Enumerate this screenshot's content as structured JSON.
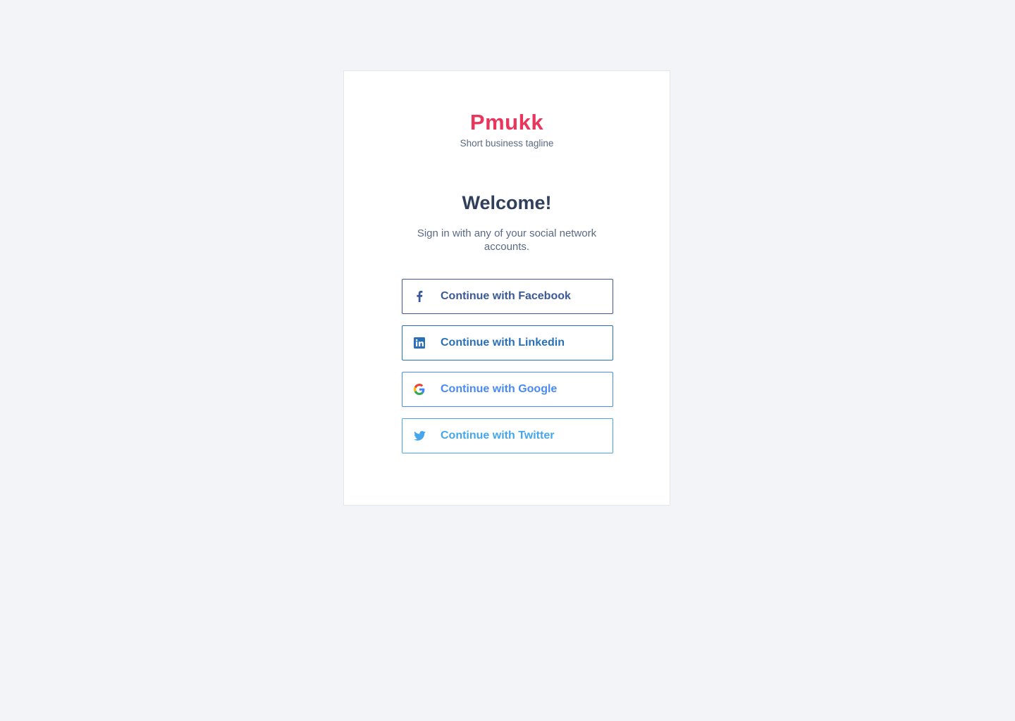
{
  "brand": {
    "name": "Pmukk",
    "tagline": "Short business tagline",
    "color": "#e8365d"
  },
  "welcome": {
    "title": "Welcome!",
    "subtitle": "Sign in with any of your social network accounts."
  },
  "buttons": [
    {
      "id": "facebook",
      "label": "Continue with Facebook",
      "icon": "facebook-icon",
      "color": "#3b5998"
    },
    {
      "id": "linkedin",
      "label": "Continue with Linkedin",
      "icon": "linkedin-icon",
      "color": "#2a70b8"
    },
    {
      "id": "google",
      "label": "Continue with Google",
      "icon": "google-icon",
      "color": "#4a8af4"
    },
    {
      "id": "twitter",
      "label": "Continue with Twitter",
      "icon": "twitter-icon",
      "color": "#45a6ec"
    }
  ]
}
